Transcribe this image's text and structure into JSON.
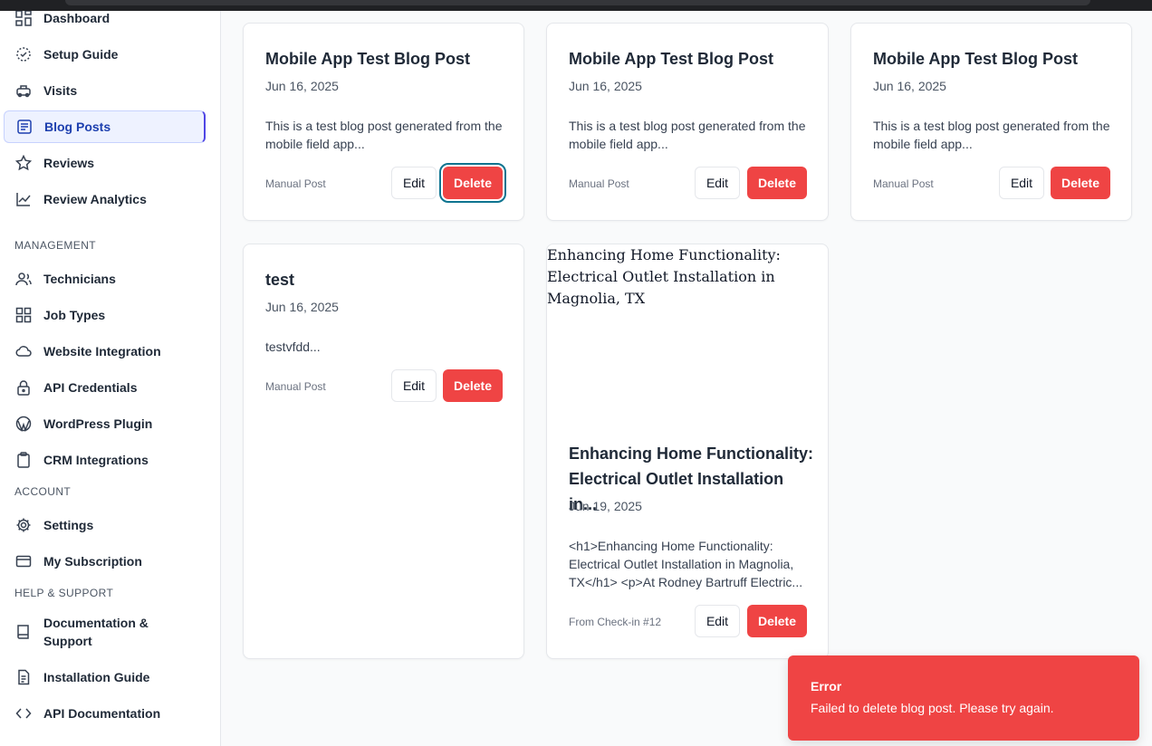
{
  "sidebar": {
    "items_top": [
      {
        "label": "Dashboard",
        "icon": "dashboard-icon"
      },
      {
        "label": "Setup Guide",
        "icon": "setup-guide-icon"
      },
      {
        "label": "Visits",
        "icon": "visits-icon"
      },
      {
        "label": "Blog Posts",
        "icon": "blog-posts-icon",
        "active": true
      },
      {
        "label": "Reviews",
        "icon": "star-icon"
      },
      {
        "label": "Review Analytics",
        "icon": "analytics-icon"
      }
    ],
    "management_label": "MANAGEMENT",
    "management": [
      {
        "label": "Technicians",
        "icon": "technicians-icon"
      },
      {
        "label": "Job Types",
        "icon": "job-types-icon"
      },
      {
        "label": "Website Integration",
        "icon": "cloud-icon"
      },
      {
        "label": "API Credentials",
        "icon": "lock-icon"
      },
      {
        "label": "WordPress Plugin",
        "icon": "wordpress-icon"
      },
      {
        "label": "CRM Integrations",
        "icon": "clipboard-icon"
      }
    ],
    "account_label": "ACCOUNT",
    "account": [
      {
        "label": "Settings",
        "icon": "gear-icon"
      },
      {
        "label": "My Subscription",
        "icon": "credit-card-icon"
      }
    ],
    "help_label": "HELP & SUPPORT",
    "help": [
      {
        "label": "Documentation & Support",
        "icon": "book-icon"
      },
      {
        "label": "Installation Guide",
        "icon": "document-icon"
      },
      {
        "label": "API Documentation",
        "icon": "code-icon"
      }
    ]
  },
  "posts": [
    {
      "title": "Mobile App Test Blog Post",
      "date": "Jun 16, 2025",
      "excerpt": "This is a test blog post generated from the mobile field app...",
      "source": "Manual Post",
      "edit": "Edit",
      "delete": "Delete"
    },
    {
      "title": "Mobile App Test Blog Post",
      "date": "Jun 16, 2025",
      "excerpt": "This is a test blog post generated from the mobile field app...",
      "source": "Manual Post",
      "edit": "Edit",
      "delete": "Delete"
    },
    {
      "title": "Mobile App Test Blog Post",
      "date": "Jun 16, 2025",
      "excerpt": "This is a test blog post generated from the mobile field app...",
      "source": "Manual Post",
      "edit": "Edit",
      "delete": "Delete"
    },
    {
      "title": "test",
      "date": "Jun 16, 2025",
      "excerpt": "testvfdd...",
      "source": "Manual Post",
      "edit": "Edit",
      "delete": "Delete"
    },
    {
      "image_alt": "Enhancing Home Functionality: Electrical Outlet Installation in Magnolia, TX",
      "title": "Enhancing Home Functionality: Electrical Outlet Installation in...",
      "date": "Jun 19, 2025",
      "excerpt": "<h1>Enhancing Home Functionality: Electrical Outlet Installation in Magnolia, TX</h1> <p>At Rodney Bartruff Electric...",
      "source": "From Check-in #12",
      "edit": "Edit",
      "delete": "Delete"
    }
  ],
  "toast": {
    "title": "Error",
    "message": "Failed to delete blog post. Please try again.",
    "color": "#ef4444"
  },
  "colors": {
    "accent": "#1e40af",
    "danger": "#ef4444"
  }
}
